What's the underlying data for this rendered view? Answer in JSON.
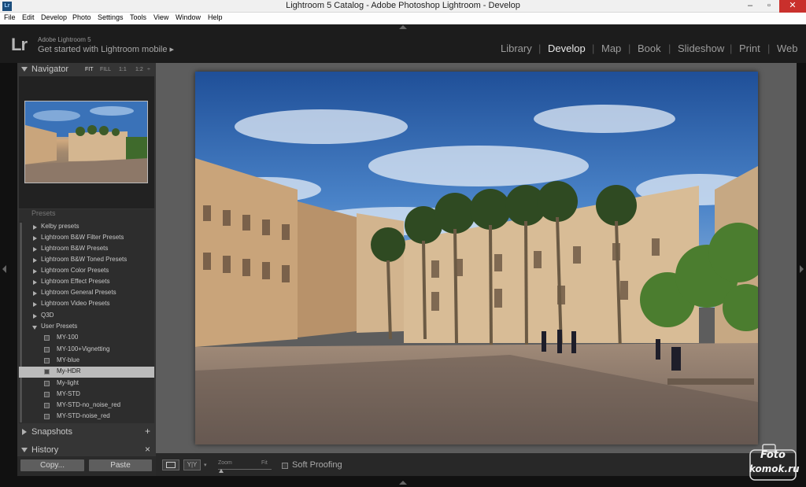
{
  "window": {
    "title": "Lightroom 5 Catalog - Adobe Photoshop Lightroom - Develop",
    "icon_text": "Lr",
    "min_symbol": "–",
    "max_symbol": "▫",
    "close_symbol": "✕"
  },
  "menu": [
    "File",
    "Edit",
    "Develop",
    "Photo",
    "Settings",
    "Tools",
    "View",
    "Window",
    "Help"
  ],
  "identity": {
    "logo": "Lr",
    "line1": "Adobe Lightroom 5",
    "line2": "Get started with Lightroom mobile  ▸"
  },
  "modules": [
    "Library",
    "Develop",
    "Map",
    "Book",
    "Slideshow",
    "Print",
    "Web"
  ],
  "module_separator": "|",
  "active_module": "Develop",
  "navigator": {
    "label": "Navigator",
    "zoom_options": [
      "FIT",
      "FILL",
      "1:1",
      "1:2"
    ],
    "zoom_menu_symbol": "÷"
  },
  "presets": {
    "header_cut": "Presets",
    "folders": [
      "Kelby presets",
      "Lightroom B&W Filter Presets",
      "Lightroom B&W Presets",
      "Lightroom B&W Toned Presets",
      "Lightroom Color Presets",
      "Lightroom Effect Presets",
      "Lightroom General Presets",
      "Lightroom Video Presets",
      "Q3D",
      "User Presets"
    ],
    "user_presets": [
      "MY-100",
      "MY-100+Vignetting",
      "MY-blue",
      "My-HDR",
      "My-light",
      "MY-STD",
      "MY-STD-no_noise_red",
      "MY-STD-noise_red"
    ],
    "selected": "My-HDR"
  },
  "snapshots": {
    "label": "Snapshots",
    "action": "+"
  },
  "history": {
    "label": "History",
    "action": "×"
  },
  "buttons": {
    "copy": "Copy...",
    "paste": "Paste"
  },
  "toolbar": {
    "view_compare_label": "Y|Y",
    "zoom_label": "Zoom",
    "fit_label": "Fit",
    "soft_proofing": "Soft Proofing"
  },
  "watermark": {
    "line1": "Foto",
    "line2": "komok.ru"
  },
  "colors": {
    "sky": "#2e66b0",
    "building": "#cfb08a",
    "palm": "#3d5e2a",
    "close_button": "#c9302c"
  }
}
